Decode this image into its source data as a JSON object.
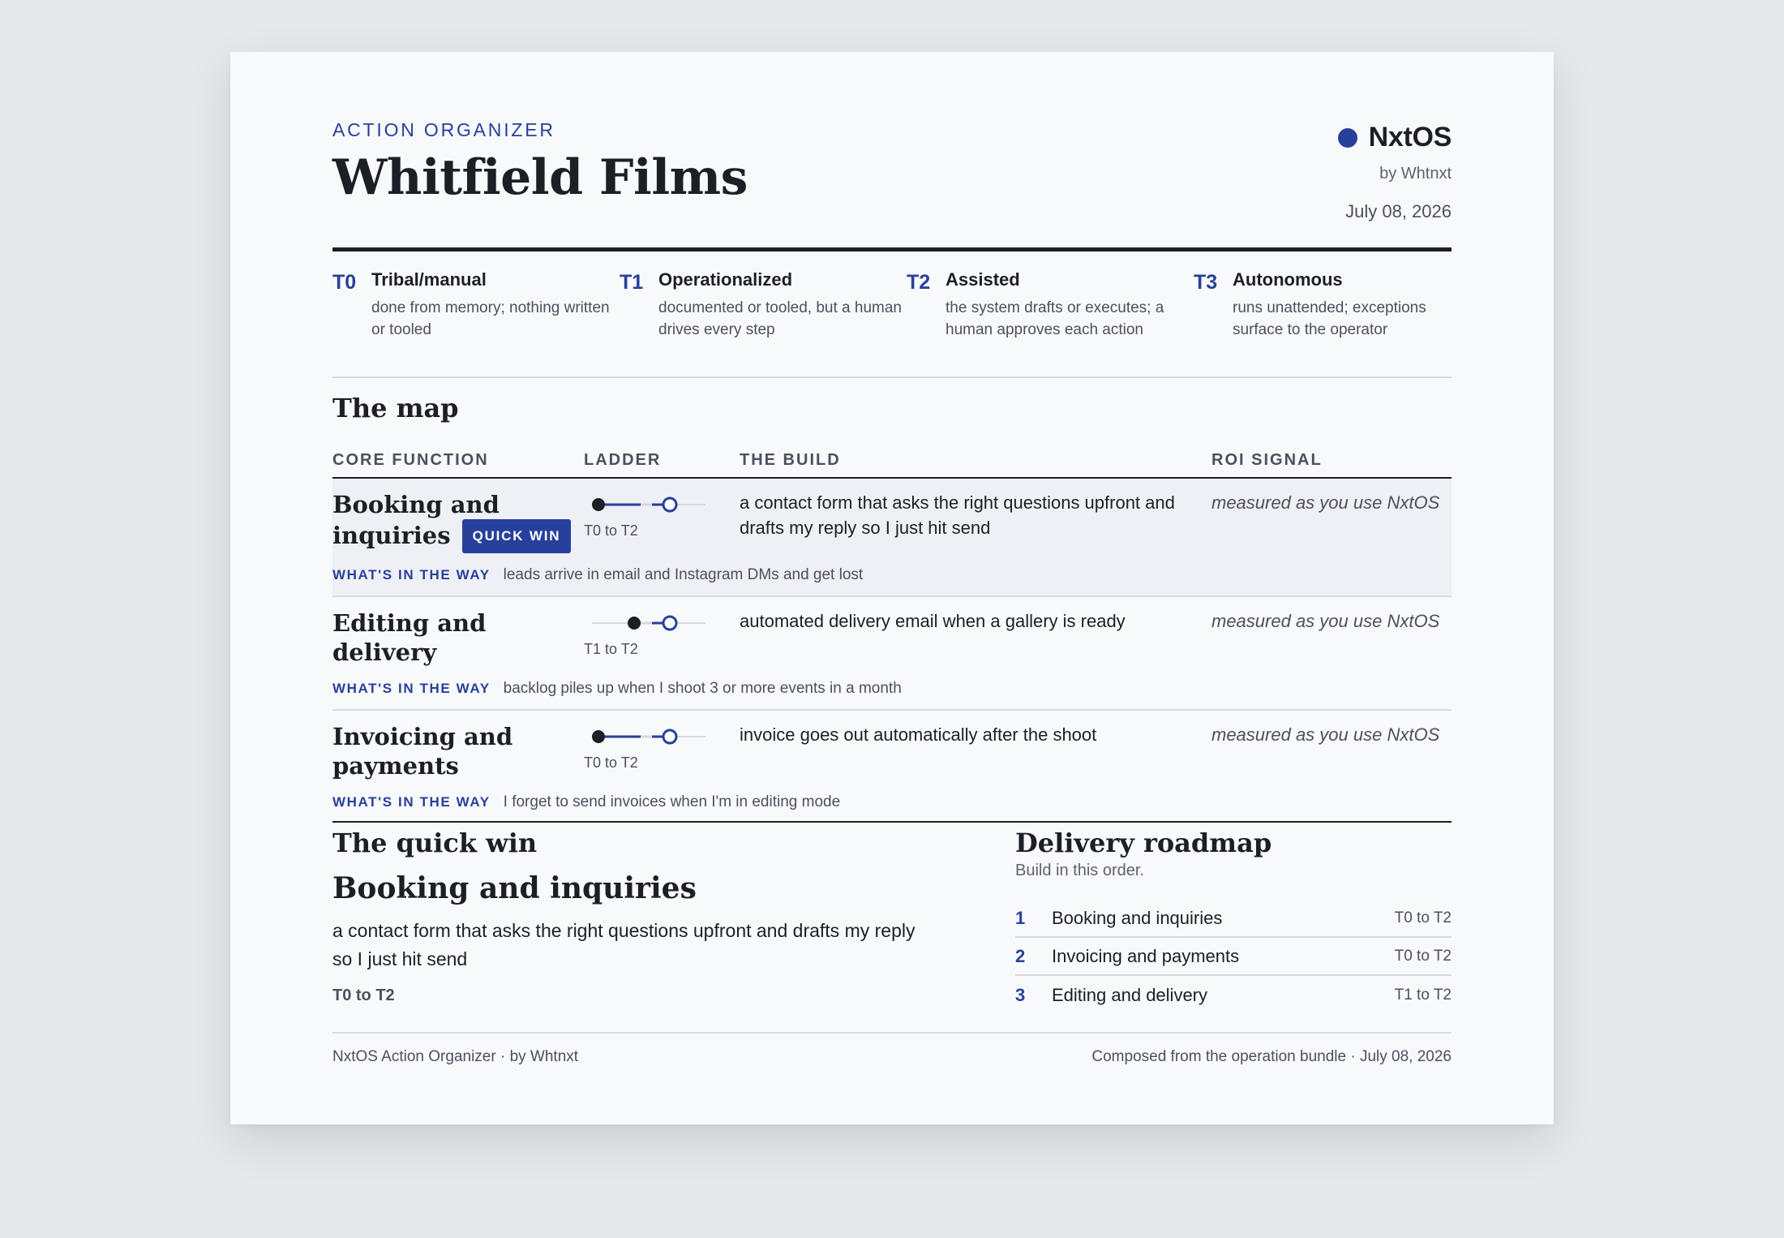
{
  "header": {
    "kicker": "ACTION ORGANIZER",
    "title": "Whitfield Films",
    "brand_name": "NxtOS",
    "brand_by": "by Whtnxt",
    "date": "July 08, 2026",
    "accent_color": "#27409b"
  },
  "tiers": [
    {
      "code": "T0",
      "name": "Tribal/manual",
      "desc": "done from memory; nothing written or tooled"
    },
    {
      "code": "T1",
      "name": "Operationalized",
      "desc": "documented or tooled, but a human drives every step"
    },
    {
      "code": "T2",
      "name": "Assisted",
      "desc": "the system drafts or executes; a human approves each action"
    },
    {
      "code": "T3",
      "name": "Autonomous",
      "desc": "runs unattended; exceptions surface to the operator"
    }
  ],
  "map": {
    "title": "The map",
    "columns": {
      "function": "CORE FUNCTION",
      "ladder": "LADDER",
      "build": "THE BUILD",
      "roi": "ROI SIGNAL"
    },
    "way_label": "WHAT'S IN THE WAY",
    "rows": [
      {
        "function": "Booking and inquiries",
        "function_line1": "Booking and",
        "function_line2": "inquiries",
        "badge": "QUICK WIN",
        "from_tier": 0,
        "to_tier": 2,
        "ladder_label": "T0 to T2",
        "build": "a contact form that asks the right questions upfront and drafts my reply so I just hit send",
        "roi": "measured as you use NxtOS",
        "way": "leads arrive in email and Instagram DMs and get lost"
      },
      {
        "function": "Editing and delivery",
        "from_tier": 1,
        "to_tier": 2,
        "ladder_label": "T1 to T2",
        "build": "automated delivery email when a gallery is ready",
        "roi": "measured as you use NxtOS",
        "way": "backlog piles up when I shoot 3 or more events in a month"
      },
      {
        "function": "Invoicing and payments",
        "function_line1": "Invoicing and",
        "function_line2": "payments",
        "from_tier": 0,
        "to_tier": 2,
        "ladder_label": "T0 to T2",
        "build": "invoice goes out automatically after the shoot",
        "roi": "measured as you use NxtOS",
        "way": "I forget to send invoices when I'm in editing mode"
      }
    ]
  },
  "quick_win": {
    "heading": "The quick win",
    "title": "Booking and inquiries",
    "desc": "a contact form that asks the right questions upfront and drafts my reply so I just hit send",
    "tier": "T0 to T2"
  },
  "roadmap": {
    "heading": "Delivery roadmap",
    "subtitle": "Build in this order.",
    "items": [
      {
        "num": "1",
        "name": "Booking and inquiries",
        "tier": "T0 to T2"
      },
      {
        "num": "2",
        "name": "Invoicing and payments",
        "tier": "T0 to T2"
      },
      {
        "num": "3",
        "name": "Editing and delivery",
        "tier": "T1 to T2"
      }
    ]
  },
  "footer": {
    "left": "NxtOS Action Organizer · by Whtnxt",
    "right": "Composed from the operation bundle · July 08, 2026"
  }
}
